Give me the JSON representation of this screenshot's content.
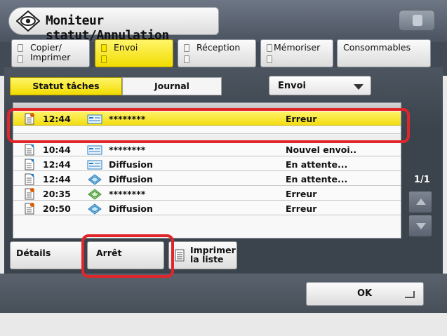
{
  "title": "Moniteur statut/Annulation",
  "tabs": [
    {
      "label": "Copier/\nImprimer",
      "active": false
    },
    {
      "label": "Envoi",
      "active": true
    },
    {
      "label": "Réception",
      "active": false
    },
    {
      "label": "Mémoriser",
      "active": false
    },
    {
      "label": "Consommables",
      "active": false
    }
  ],
  "subtabs": {
    "status_jobs": "Statut tâches",
    "journal": "Journal"
  },
  "dropdown": {
    "selected": "Envoi"
  },
  "list": {
    "rows": [
      {
        "time": "12:44",
        "dest": "********",
        "status": "Erreur",
        "doc": "error",
        "type": "fax",
        "selected": true
      },
      {
        "time": "10:44",
        "dest": "********",
        "status": "Nouvel envoi..",
        "doc": "send",
        "type": "fax",
        "selected": false
      },
      {
        "time": "12:44",
        "dest": "Diffusion",
        "status": "En attente...",
        "doc": "send",
        "type": "fax",
        "selected": false
      },
      {
        "time": "12:44",
        "dest": "Diffusion",
        "status": "En attente...",
        "doc": "send",
        "type": "multi",
        "selected": false
      },
      {
        "time": "20:35",
        "dest": "********",
        "status": "Erreur",
        "doc": "error",
        "type": "multi",
        "selected": false
      },
      {
        "time": "20:50",
        "dest": "Diffusion",
        "status": "Erreur",
        "doc": "error",
        "type": "multi",
        "selected": false
      }
    ]
  },
  "pager": {
    "text": "1/1"
  },
  "buttons": {
    "details": "Détails",
    "stop": "Arrêt",
    "print_list": "Imprimer\nla liste",
    "ok": "OK"
  },
  "colors": {
    "accent_yellow": "#f2dc00",
    "callout_red": "#e0262b",
    "panel_dark": "#3b434d"
  }
}
